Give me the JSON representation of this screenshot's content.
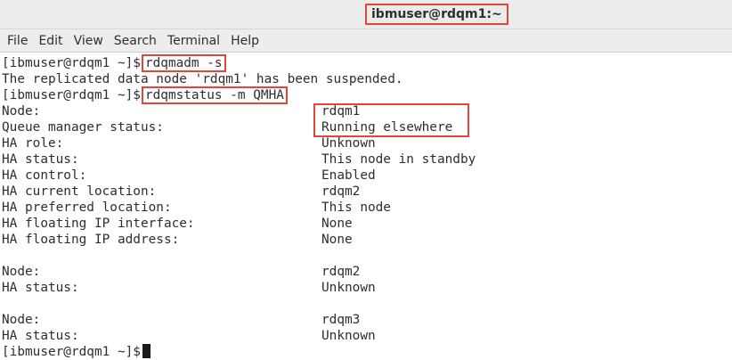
{
  "window": {
    "title": "ibmuser@rdqm1:~"
  },
  "menu": [
    "File",
    "Edit",
    "View",
    "Search",
    "Terminal",
    "Help"
  ],
  "terminal": {
    "prompt": "[ibmuser@rdqm1 ~]$",
    "cmd1": "rdqmadm -s",
    "out1": "The replicated data node 'rdqm1' has been suspended.",
    "cmd2": "rdqmstatus -m QMHA",
    "rows": [
      {
        "label": "Node:",
        "value": "rdqm1"
      },
      {
        "label": "Queue manager status:",
        "value": "Running elsewhere"
      },
      {
        "label": "HA role:",
        "value": "Unknown"
      },
      {
        "label": "HA status:",
        "value": "This node in standby"
      },
      {
        "label": "HA control:",
        "value": "Enabled"
      },
      {
        "label": "HA current location:",
        "value": "rdqm2"
      },
      {
        "label": "HA preferred location:",
        "value": "This node"
      },
      {
        "label": "HA floating IP interface:",
        "value": "None"
      },
      {
        "label": "HA floating IP address:",
        "value": "None"
      }
    ],
    "node2": [
      {
        "label": "Node:",
        "value": "rdqm2"
      },
      {
        "label": "HA status:",
        "value": "Unknown"
      }
    ],
    "node3": [
      {
        "label": "Node:",
        "value": "rdqm3"
      },
      {
        "label": "HA status:",
        "value": "Unknown"
      }
    ]
  }
}
